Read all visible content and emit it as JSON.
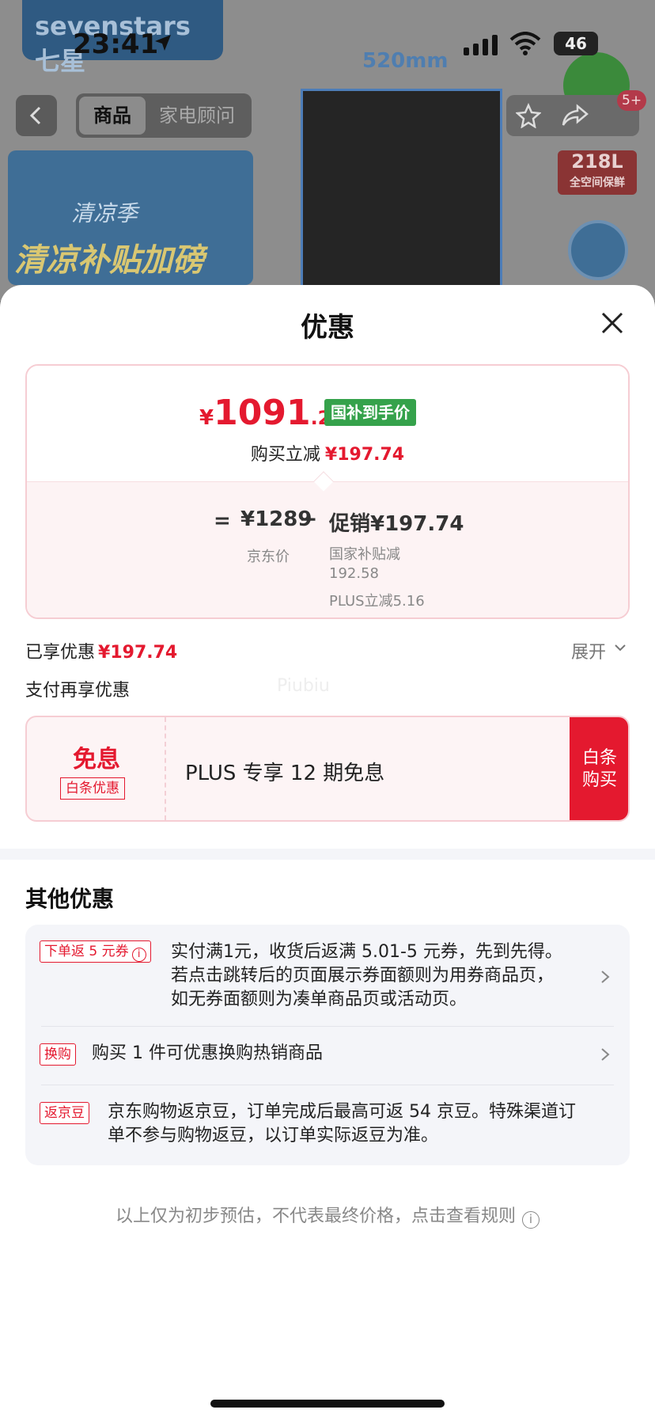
{
  "status_bar": {
    "time": "23:41",
    "battery": "46"
  },
  "background": {
    "brand": "sevenstars 七星",
    "promo_small": "清凉季",
    "promo_big": "清凉补贴加磅",
    "dimension": "520mm",
    "capacity": "218L",
    "capacity_sub": "全空间保鲜",
    "nav_tabs": [
      "商品",
      "家电顾问"
    ],
    "share_badge": "5+"
  },
  "sheet": {
    "title": "优惠",
    "price_card": {
      "currency": "¥",
      "price_int": "1091",
      "price_dec": ".26",
      "tag": "国补到手价",
      "reduce_label": "购买立减",
      "reduce_amount": "¥197.74",
      "equals": "=",
      "jd_price": "¥1289",
      "jd_label": "京东价",
      "minus": "−",
      "promo_label": "促销¥197.74",
      "subsidy_label": "国家补贴减",
      "subsidy_amount": "192.58",
      "plus_label": "PLUS立减5.16"
    },
    "enjoyed_label": "已享优惠",
    "enjoyed_amount": "¥197.74",
    "expand_label": "展开",
    "pay_more_label": "支付再享优惠",
    "watermark": "Piubiu",
    "baitiao": {
      "title": "免息",
      "tag": "白条优惠",
      "text": "PLUS 专享 12 期免息",
      "button_line1": "白条",
      "button_line2": "购买"
    },
    "other": {
      "title": "其他优惠",
      "rows": [
        {
          "tag": "下单返 5 元券",
          "text_lines": [
            "实付满1元，收货后返满 5.01-5 元券，先到先得。",
            "若点击跳转后的页面展示券面额则为用券商品页，",
            "如无券面额则为凑单商品页或活动页。"
          ]
        },
        {
          "tag": "换购",
          "text_lines": [
            "购买 1 件可优惠换购热销商品"
          ]
        },
        {
          "tag": "返京豆",
          "text_lines": [
            "京东购物返京豆，订单完成后最高可返 54 京豆。特殊渠道订",
            "单不参与购物返豆，以订单实际返豆为准。"
          ]
        }
      ]
    },
    "footer_note": "以上仅为初步预估，不代表最终价格，点击查看规则"
  }
}
